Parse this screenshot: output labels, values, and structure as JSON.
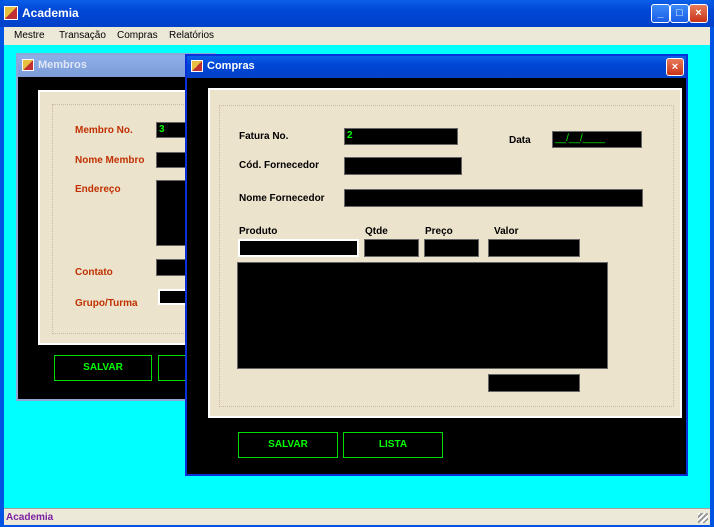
{
  "app": {
    "title": "Academia",
    "minimize": "_",
    "maximize": "□",
    "close": "×"
  },
  "menu": [
    "Mestre",
    "Transação",
    "Compras",
    "Relatórios"
  ],
  "status": "Academia",
  "membros": {
    "title": "Membros",
    "membro_no_label": "Membro No.",
    "membro_no_value": "3",
    "nome_label": "Nome Membro",
    "endereco_label": "Endereço",
    "contato_label": "Contato",
    "grupo_label": "Grupo/Turma",
    "salvar": "SALVAR"
  },
  "compras": {
    "title": "Compras",
    "close": "×",
    "fatura_label": "Fatura No.",
    "fatura_value": "2",
    "data_label": "Data",
    "data_value": "__/__/____",
    "cod_fornecedor_label": "Cód. Fornecedor",
    "nome_fornecedor_label": "Nome Fornecedor",
    "produto_label": "Produto",
    "qtde_label": "Qtde",
    "preco_label": "Preço",
    "valor_label": "Valor",
    "salvar": "SALVAR",
    "lista": "LISTA"
  }
}
